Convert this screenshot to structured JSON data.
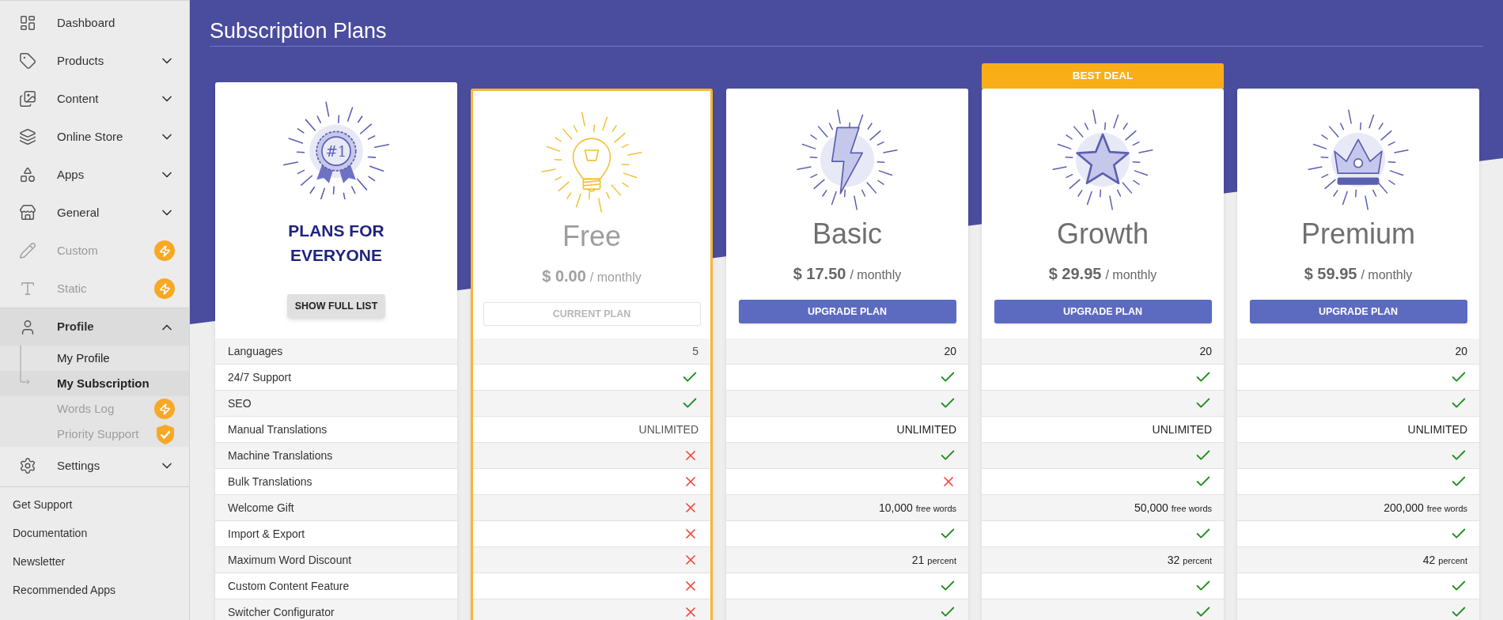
{
  "sidebar": {
    "items": [
      {
        "label": "Dashboard",
        "selected": false,
        "disabled": false
      },
      {
        "label": "Products",
        "expanded": false,
        "selected": false,
        "disabled": false
      },
      {
        "label": "Content",
        "expanded": false,
        "selected": false,
        "disabled": false
      },
      {
        "label": "Online Store",
        "expanded": false,
        "selected": false,
        "disabled": false
      },
      {
        "label": "Apps",
        "expanded": false,
        "selected": false,
        "disabled": false
      },
      {
        "label": "General",
        "expanded": false,
        "selected": false,
        "disabled": false
      },
      {
        "label": "Custom",
        "badge": {
          "kind": "bolt"
        },
        "selected": false,
        "disabled": true
      },
      {
        "label": "Static",
        "badge": {
          "kind": "bolt"
        },
        "selected": false,
        "disabled": true
      },
      {
        "label": "Profile",
        "expanded": true,
        "selected": true,
        "disabled": false,
        "children": [
          {
            "label": "My Profile",
            "selected": false,
            "disabled": false
          },
          {
            "label": "My Subscription",
            "selected": true,
            "disabled": false
          },
          {
            "label": "Words Log",
            "badge": {
              "kind": "bolt"
            },
            "selected": false,
            "disabled": true
          },
          {
            "label": "Priority Support",
            "badge": {
              "kind": "shield"
            },
            "selected": false,
            "disabled": true
          }
        ]
      },
      {
        "label": "Settings",
        "expanded": false,
        "selected": false,
        "disabled": false
      }
    ],
    "links": [
      "Get Support",
      "Documentation",
      "Newsletter",
      "Recommended Apps"
    ]
  },
  "title": "Subscription Plans",
  "features_card": {
    "emblem_text": "#1",
    "heading": "PLANS FOR EVERYONE",
    "button": "SHOW FULL LIST",
    "features": [
      "Languages",
      "24/7 Support",
      "SEO",
      "Manual Translations",
      "Machine Translations",
      "Bulk Translations",
      "Welcome Gift",
      "Import & Export",
      "Maximum Word Discount",
      "Custom Content Feature",
      "Switcher Configurator"
    ]
  },
  "plans": [
    {
      "name": "Free",
      "price": "$ 0.00",
      "period": "/ monthly",
      "current": true,
      "button": {
        "label": "CURRENT PLAN",
        "disabled": true
      },
      "cells": [
        {
          "kind": "text",
          "text": "5"
        },
        {
          "kind": "yes"
        },
        {
          "kind": "yes"
        },
        {
          "kind": "text",
          "text": "UNLIMITED"
        },
        {
          "kind": "no"
        },
        {
          "kind": "no"
        },
        {
          "kind": "no"
        },
        {
          "kind": "no"
        },
        {
          "kind": "no"
        },
        {
          "kind": "no"
        },
        {
          "kind": "no"
        }
      ]
    },
    {
      "name": "Basic",
      "price": "$ 17.50",
      "period": "/ monthly",
      "current": false,
      "button": {
        "label": "UPGRADE PLAN",
        "disabled": false
      },
      "cells": [
        {
          "kind": "text",
          "text": "20"
        },
        {
          "kind": "yes"
        },
        {
          "kind": "yes"
        },
        {
          "kind": "text",
          "text": "UNLIMITED"
        },
        {
          "kind": "yes"
        },
        {
          "kind": "no"
        },
        {
          "kind": "amount",
          "text": "10,000",
          "unit": "free words"
        },
        {
          "kind": "yes"
        },
        {
          "kind": "amount",
          "text": "21",
          "unit": "percent"
        },
        {
          "kind": "yes"
        },
        {
          "kind": "yes"
        }
      ]
    },
    {
      "name": "Growth",
      "price": "$ 29.95",
      "period": "/ monthly",
      "current": false,
      "badge": "BEST DEAL",
      "button": {
        "label": "UPGRADE PLAN",
        "disabled": false
      },
      "cells": [
        {
          "kind": "text",
          "text": "20"
        },
        {
          "kind": "yes"
        },
        {
          "kind": "yes"
        },
        {
          "kind": "text",
          "text": "UNLIMITED"
        },
        {
          "kind": "yes"
        },
        {
          "kind": "yes"
        },
        {
          "kind": "amount",
          "text": "50,000",
          "unit": "free words"
        },
        {
          "kind": "yes"
        },
        {
          "kind": "amount",
          "text": "32",
          "unit": "percent"
        },
        {
          "kind": "yes"
        },
        {
          "kind": "yes"
        }
      ]
    },
    {
      "name": "Premium",
      "price": "$ 59.95",
      "period": "/ monthly",
      "current": false,
      "button": {
        "label": "UPGRADE PLAN",
        "disabled": false
      },
      "cells": [
        {
          "kind": "text",
          "text": "20"
        },
        {
          "kind": "yes"
        },
        {
          "kind": "yes"
        },
        {
          "kind": "text",
          "text": "UNLIMITED"
        },
        {
          "kind": "yes"
        },
        {
          "kind": "yes"
        },
        {
          "kind": "amount",
          "text": "200,000",
          "unit": "free words"
        },
        {
          "kind": "yes"
        },
        {
          "kind": "amount",
          "text": "42",
          "unit": "percent"
        },
        {
          "kind": "yes"
        },
        {
          "kind": "yes"
        }
      ]
    }
  ]
}
